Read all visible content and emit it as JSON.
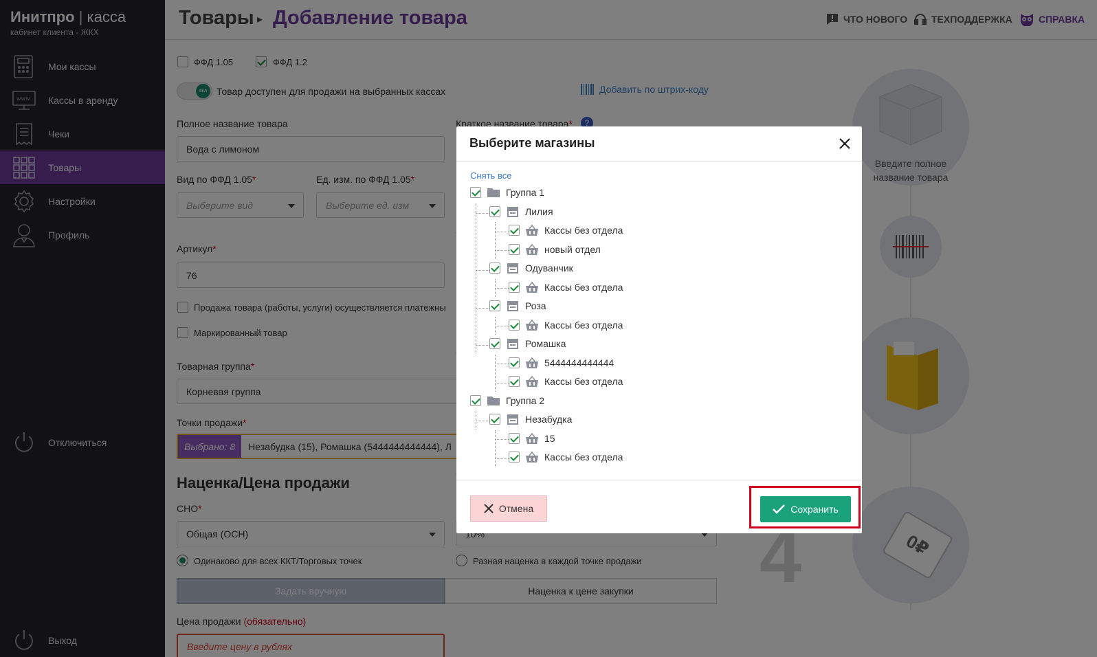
{
  "brand": {
    "name_bold": "Инитпро",
    "separator": "|",
    "name_light": "касса",
    "subtitle": "кабинет клиента - ЖКХ"
  },
  "sidebar": {
    "items": [
      {
        "label": "Мои кассы",
        "icon": "register-icon"
      },
      {
        "label": "Кассы в аренду",
        "icon": "www-monitor-icon"
      },
      {
        "label": "Чеки",
        "icon": "receipt-icon"
      },
      {
        "label": "Товары",
        "icon": "grid-icon",
        "active": true
      },
      {
        "label": "Настройки",
        "icon": "gear-icon"
      },
      {
        "label": "Профиль",
        "icon": "user-icon"
      }
    ],
    "disconnect": "Отключиться",
    "logout": "Выход"
  },
  "header": {
    "breadcrumb_root": "Товары",
    "breadcrumb_current": "Добавление товара",
    "links": {
      "whats_new": "ЧТО НОВОГО",
      "support": "ТЕХПОДДЕРЖКА",
      "help": "СПРАВКА"
    }
  },
  "form": {
    "ffd105": "ФФД 1.05",
    "ffd12": "ФФД 1.2",
    "toggle_on": "вкл",
    "toggle_label": "Товар доступен для продажи на выбранных кассах",
    "barcode_link": "Добавить по штрих-коду",
    "full_name_label": "Полное название товара",
    "full_name_value": "Вода с лимоном",
    "short_name_label": "Краткое название товара",
    "req": "*",
    "help_q": "?",
    "kind_label": "Вид по ФФД 1.05",
    "kind_placeholder": "Выберите вид",
    "unit_label": "Ед. изм. по ФФД 1.05",
    "unit_placeholder": "Выберите ед. изм",
    "article_label": "Артикул",
    "article_value": "76",
    "agent_checkbox": "Продажа товара (работы, услуги) осуществляется платежны",
    "marked_checkbox": "Маркированный товар",
    "group_label": "Товарная группа",
    "group_value": "Корневая группа",
    "points_label": "Точки продажи",
    "points_badge": "Выбрано: 8",
    "points_value": "Незабудка (15), Ромашка (5444444444444), Л",
    "markup_heading": "Наценка/Цена продажи",
    "sno_label": "СНО",
    "sno_value": "Общая (ОСН)",
    "vat_value": "10%",
    "radio_same": "Одинаково для всех ККТ/Торговых точек",
    "radio_diff": "Разная наценка в каждой точке продажи",
    "seg_manual": "Задать вручную",
    "seg_markup": "Наценка к цене закупки",
    "price_label": "Цена продажи",
    "price_required": "(обязательно)",
    "price_placeholder": "Введите цену в рублях"
  },
  "right_panel": {
    "hint": "Введите полное название товара",
    "step_number": "4",
    "price_tag": "0₽"
  },
  "modal": {
    "title": "Выберите магазины",
    "deselect_all": "Снять все",
    "tree": [
      {
        "label": "Группа 1",
        "level": 0,
        "type": "folder"
      },
      {
        "label": "Лилия",
        "level": 1,
        "type": "store"
      },
      {
        "label": "Кассы без отдела",
        "level": 2,
        "type": "basket"
      },
      {
        "label": "новый отдел",
        "level": 2,
        "type": "basket"
      },
      {
        "label": "Одуванчик",
        "level": 1,
        "type": "store"
      },
      {
        "label": "Кассы без отдела",
        "level": 2,
        "type": "basket"
      },
      {
        "label": "Роза",
        "level": 1,
        "type": "store"
      },
      {
        "label": "Кассы без отдела",
        "level": 2,
        "type": "basket"
      },
      {
        "label": "Ромашка",
        "level": 1,
        "type": "store"
      },
      {
        "label": "5444444444444",
        "level": 2,
        "type": "basket"
      },
      {
        "label": "Кассы без отдела",
        "level": 2,
        "type": "basket"
      },
      {
        "label": "Группа 2",
        "level": 0,
        "type": "folder"
      },
      {
        "label": "Незабудка",
        "level": 1,
        "type": "store"
      },
      {
        "label": "15",
        "level": 2,
        "type": "basket"
      },
      {
        "label": "Кассы без отдела",
        "level": 2,
        "type": "basket"
      }
    ],
    "cancel": "Отмена",
    "save": "Сохранить"
  },
  "colors": {
    "sidebar_bg": "#24242d",
    "accent_purple": "#6c3a9a",
    "save_green": "#1aa37a",
    "cancel_pink": "#fcd6d6",
    "highlight_red": "#d0021b"
  }
}
